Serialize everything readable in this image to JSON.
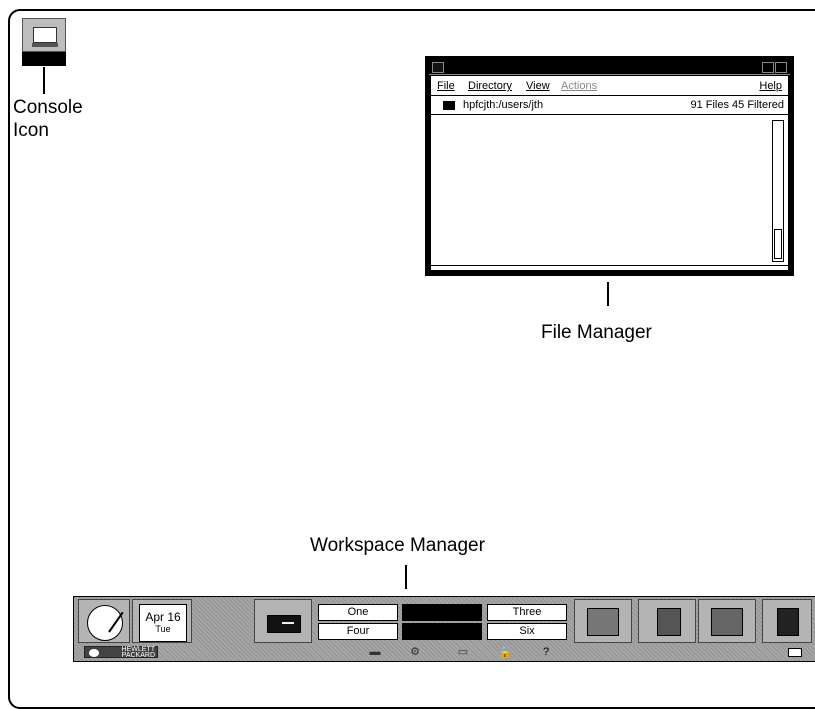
{
  "labels": {
    "console_icon_line1": "Console",
    "console_icon_line2": "Icon",
    "file_manager": "File Manager",
    "workspace_manager": "Workspace Manager"
  },
  "file_manager": {
    "menu": {
      "file": "File",
      "directory": "Directory",
      "view": "View",
      "actions": "Actions",
      "help": "Help"
    },
    "path": "hpfcjth:/users/jth",
    "file_count": "91 Files 45 Filtered"
  },
  "front_panel": {
    "date": "Apr 16",
    "day": "Tue",
    "workspaces": [
      "One",
      "",
      "Three",
      "Four",
      "",
      "Six"
    ],
    "brand_line1": "HEWLETT",
    "brand_line2": "PACKARD",
    "help_glyph": "?"
  },
  "icons": {
    "console": "terminal-console-icon",
    "clock": "clock-icon",
    "calendar": "calendar-icon",
    "mail": "mail-icon",
    "printer": "printer-icon",
    "style": "style-manager-icon",
    "app_manager": "application-manager-icon",
    "trash": "trash-icon",
    "lock": "lock-icon",
    "help": "help-icon"
  }
}
